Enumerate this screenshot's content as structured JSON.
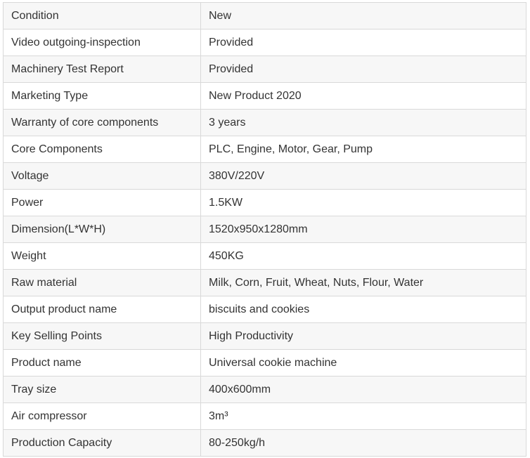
{
  "specs": [
    {
      "label": "Condition",
      "value": "New"
    },
    {
      "label": "Video outgoing-inspection",
      "value": "Provided"
    },
    {
      "label": "Machinery Test Report",
      "value": "Provided"
    },
    {
      "label": "Marketing Type",
      "value": "New Product 2020"
    },
    {
      "label": "Warranty of core components",
      "value": "3 years"
    },
    {
      "label": "Core Components",
      "value": "PLC, Engine, Motor, Gear, Pump"
    },
    {
      "label": "Voltage",
      "value": "380V/220V"
    },
    {
      "label": "Power",
      "value": "1.5KW"
    },
    {
      "label": "Dimension(L*W*H)",
      "value": "1520x950x1280mm"
    },
    {
      "label": "Weight",
      "value": "450KG"
    },
    {
      "label": "Raw material",
      "value": "Milk, Corn, Fruit, Wheat, Nuts, Flour, Water"
    },
    {
      "label": "Output product name",
      "value": "biscuits and cookies"
    },
    {
      "label": "Key Selling Points",
      "value": "High Productivity"
    },
    {
      "label": "Product name",
      "value": "Universal cookie machine"
    },
    {
      "label": "Tray size",
      "value": "400x600mm"
    },
    {
      "label": "Air compressor",
      "value": "3m³"
    },
    {
      "label": "Production Capacity",
      "value": "80-250kg/h"
    }
  ]
}
